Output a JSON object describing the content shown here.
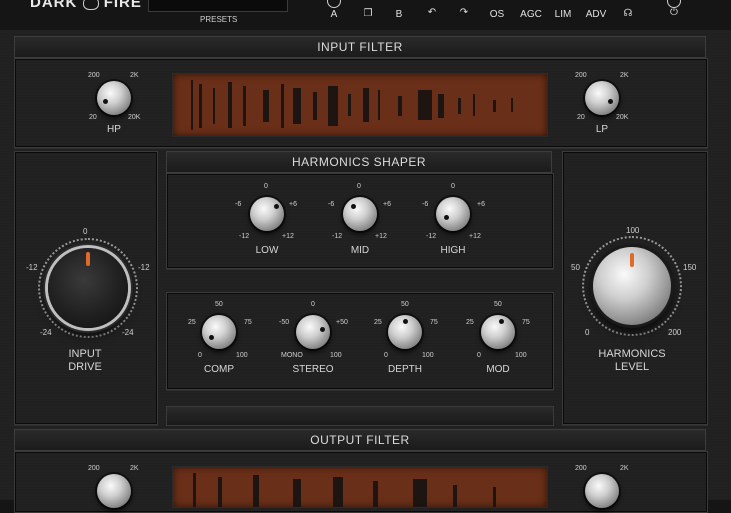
{
  "brand": {
    "left": "DARK",
    "right": "FIRE"
  },
  "presets": {
    "label": "PRESETS"
  },
  "toolbar": {
    "a": "A",
    "b": "B",
    "os": "OS",
    "agc": "AGC",
    "lim": "LIM",
    "adv": "ADV",
    "icons": [
      "copy-icon",
      "undo-icon",
      "redo-icon",
      "headphones-icon",
      "power-icon"
    ]
  },
  "input_filter": {
    "title": "INPUT FILTER",
    "hp": {
      "label": "HP",
      "t200": "200",
      "t2k": "2K",
      "t20": "20",
      "t20k": "20K"
    },
    "lp": {
      "label": "LP",
      "t200": "200",
      "t2k": "2K",
      "t20": "20",
      "t20k": "20K"
    }
  },
  "harmonics_shaper": {
    "title": "HARMONICS SHAPER",
    "eq": [
      {
        "label": "LOW",
        "t0": "0",
        "tm6": "-6",
        "tp6": "+6",
        "tm12": "-12",
        "tp12": "+12"
      },
      {
        "label": "MID",
        "t0": "0",
        "tm6": "-6",
        "tp6": "+6",
        "tm12": "-12",
        "tp12": "+12"
      },
      {
        "label": "HIGH",
        "t0": "0",
        "tm6": "-6",
        "tp6": "+6",
        "tm12": "-12",
        "tp12": "+12"
      }
    ],
    "dyn": [
      {
        "label": "COMP",
        "top": "50",
        "l": "25",
        "r": "75",
        "bl": "0",
        "br": "100"
      },
      {
        "label": "STEREO",
        "top": "0",
        "l": "-50",
        "r": "+50",
        "bl": "MONO",
        "br": "100"
      },
      {
        "label": "DEPTH",
        "top": "50",
        "l": "25",
        "r": "75",
        "bl": "0",
        "br": "100"
      },
      {
        "label": "MOD",
        "top": "50",
        "l": "25",
        "r": "75",
        "bl": "0",
        "br": "100"
      }
    ]
  },
  "input_drive": {
    "label1": "INPUT",
    "label2": "DRIVE",
    "t0": "0",
    "tm12l": "-12",
    "tm12r": "-12",
    "tm24l": "-24",
    "tm24r": "-24"
  },
  "harmonics_level": {
    "label1": "HARMONICS",
    "label2": "LEVEL",
    "t100": "100",
    "t50": "50",
    "t150": "150",
    "t0": "0",
    "t200": "200"
  },
  "output_filter": {
    "title": "OUTPUT FILTER",
    "hp": {
      "t200": "200",
      "t2k": "2K"
    },
    "lp": {
      "t200": "200",
      "t2k": "2K"
    }
  },
  "colors": {
    "accent": "#e06a2a",
    "screen": "#6a2f18",
    "panel": "#1e1e1e"
  }
}
